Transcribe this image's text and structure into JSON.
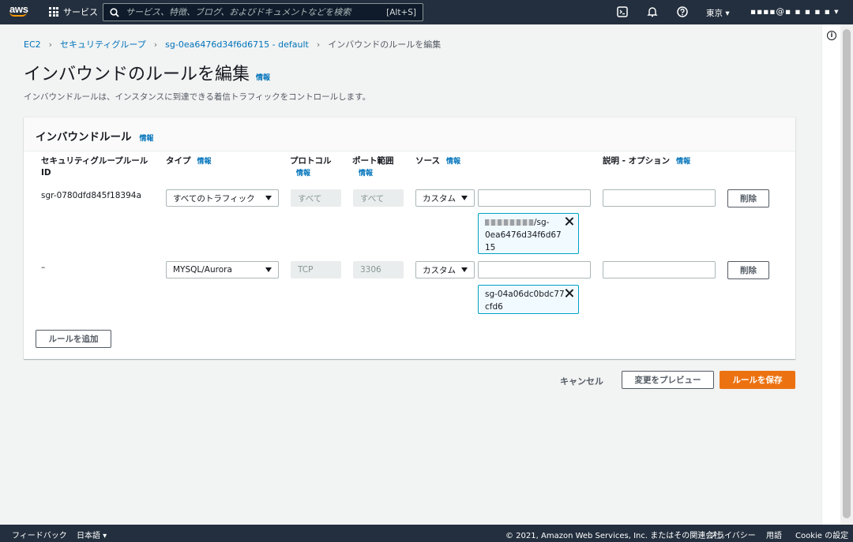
{
  "topnav": {
    "logo_text": "aws",
    "services_label": "サービス",
    "search_placeholder": "サービス、特徴、ブログ、およびドキュメントなどを検索",
    "search_shortcut": "[Alt+S]",
    "region_label": "東京 ▾",
    "account_label": "▪▪▪▪@▪ ▪ ▪ ▪ ▪ ▾"
  },
  "breadcrumb": {
    "items": [
      "EC2",
      "セキュリティグループ",
      "sg-0ea6476d34f6d6715 - default"
    ],
    "current": "インバウンドのルールを編集"
  },
  "page": {
    "title": "インバウンドのルールを編集",
    "title_info": "情報",
    "description": "インバウンドルールは、インスタンスに到達できる着信トラフィックをコントロールします。"
  },
  "panel": {
    "title": "インバウンドルール",
    "title_info": "情報",
    "columns": {
      "rule_id_line1": "セキュリティグループルール",
      "rule_id_line2": "ID",
      "type": "タイプ",
      "protocol": "プロトコル",
      "port_range": "ポート範囲",
      "source": "ソース",
      "description": "説明 - オプション",
      "info": "情報"
    },
    "rows": [
      {
        "rule_id": "sgr-0780dfd845f18394a",
        "type": "すべてのトラフィック",
        "protocol": "すべて",
        "port_range": "すべて",
        "source_type": "カスタム",
        "token_line1_suffix": "/sg-",
        "token_line2": "0ea6476d34f6d67",
        "token_line3": "15",
        "delete_label": "削除"
      },
      {
        "rule_id": "–",
        "type": "MYSQL/Aurora",
        "protocol": "TCP",
        "port_range": "3306",
        "source_type": "カスタム",
        "token_line1": "sg-04a06dc0bdc77",
        "token_line2": "cfd6",
        "delete_label": "削除"
      }
    ],
    "add_rule_label": "ルールを追加"
  },
  "actions": {
    "cancel": "キャンセル",
    "preview": "変更をプレビュー",
    "save": "ルールを保存"
  },
  "footer": {
    "feedback": "フィードバック",
    "language": "日本語 ▾",
    "copyright": "© 2021, Amazon Web Services, Inc. またはその関連会社。",
    "privacy": "プライバシー",
    "terms": "用語",
    "cookie": "Cookie の設定"
  },
  "colors": {
    "nav_bg": "#232f3e",
    "link": "#0073bb",
    "primary": "#ec7211",
    "token_border": "#00a1c9"
  }
}
